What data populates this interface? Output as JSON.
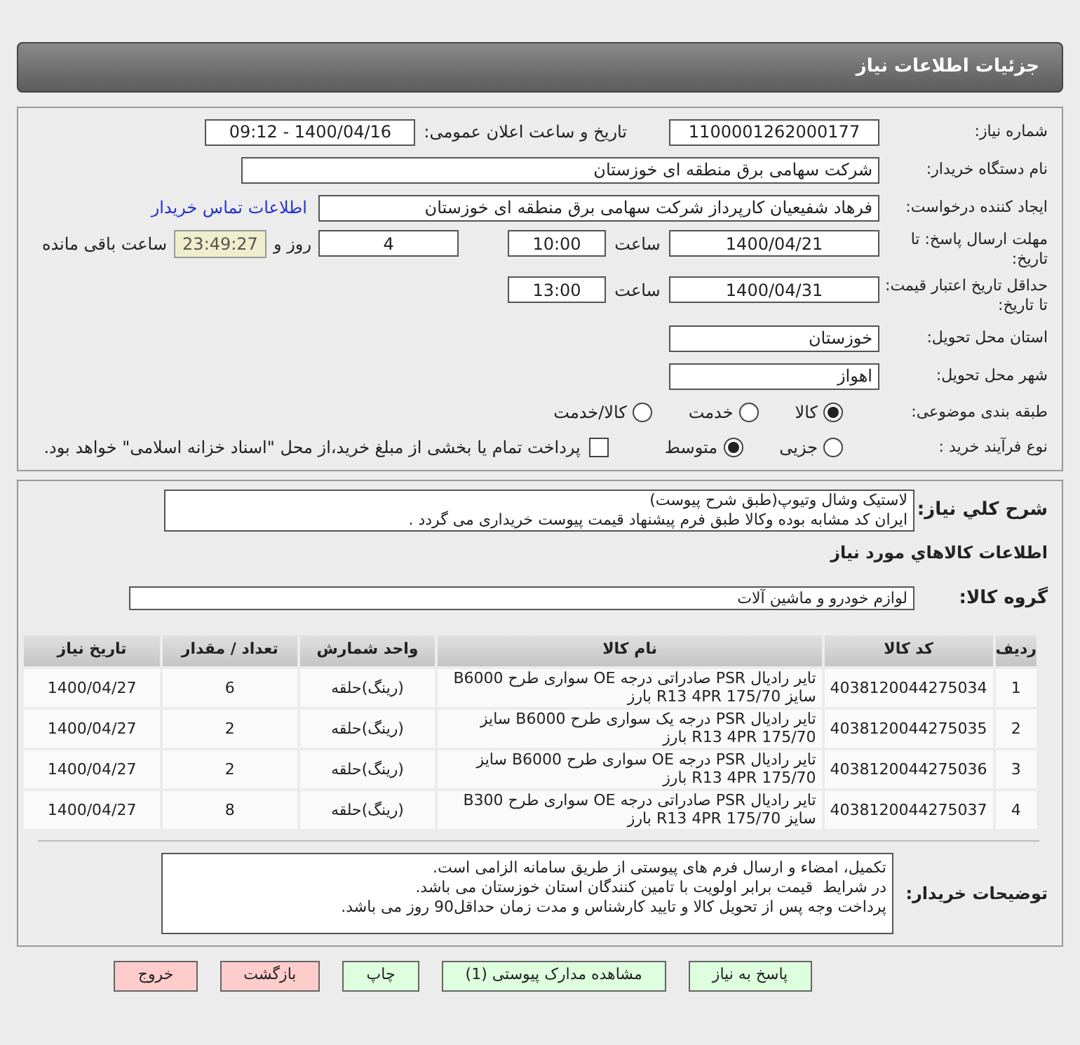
{
  "header": {
    "title": "جزئیات اطلاعات نیاز"
  },
  "need_number": {
    "label": "شماره نیاز:",
    "value": "1100001262000177"
  },
  "announce": {
    "label": "تاریخ و ساعت اعلان عمومی:",
    "value": "1400/04/16 - 09:12"
  },
  "buyer_org": {
    "label": "نام دستگاه خریدار:",
    "value": "شرکت سهامی برق منطقه ای خوزستان"
  },
  "requester": {
    "label": "ایجاد کننده درخواست:",
    "value": "فرهاد شفیعیان کارپرداز شرکت سهامی برق منطقه ای خوزستان",
    "link": "اطلاعات تماس خریدار"
  },
  "deadline": {
    "label": "مهلت ارسال پاسخ: تا تاریخ:",
    "date": "1400/04/21",
    "time_label": "ساعت",
    "time": "10:00",
    "days": "4",
    "days_label": "روز و",
    "remaining": "23:49:27",
    "remaining_label": "ساعت باقی مانده"
  },
  "validity": {
    "label": "حداقل تاریخ اعتبار قیمت: تا تاریخ:",
    "date": "1400/04/31",
    "time_label": "ساعت",
    "time": "13:00"
  },
  "province": {
    "label": "استان محل تحویل:",
    "value": "خوزستان"
  },
  "city": {
    "label": "شهر محل تحویل:",
    "value": "اهواز"
  },
  "category": {
    "label": "طبقه بندی موضوعی:",
    "options": [
      {
        "label": "کالا",
        "selected": true
      },
      {
        "label": "خدمت",
        "selected": false
      },
      {
        "label": "کالا/خدمت",
        "selected": false
      }
    ]
  },
  "process": {
    "label": "نوع فرآیند خرید :",
    "options": [
      {
        "label": "جزیی",
        "selected": false
      },
      {
        "label": "متوسط",
        "selected": true
      }
    ],
    "payment": {
      "checked": false,
      "label": "پرداخت تمام یا بخشی از مبلغ خرید،از محل \"اسناد خزانه اسلامی\" خواهد بود."
    }
  },
  "description": {
    "label": "شرح کلي نياز:",
    "lines": [
      "لاستیک وشال وتیوپ(طبق شرح پیوست)",
      "ایران کد مشابه بوده وکالا طبق فرم پیشنهاد قیمت پیوست خریداری می گردد ."
    ]
  },
  "items_title": "اطلاعات کالاهاي مورد نياز",
  "group": {
    "label": "گروه کالا:",
    "value": "لوازم خودرو و ماشین آلات"
  },
  "table": {
    "columns": [
      "ردیف",
      "کد کالا",
      "نام کالا",
      "واحد شمارش",
      "تعداد / مقدار",
      "تاریخ نیاز"
    ],
    "rows": [
      [
        "1",
        "4038120044275034",
        "تایر رادیال PSR صادراتی درجه OE سواری طرح B6000 سایز 175/70 R13 4PR بارز",
        "(رینگ)حلقه",
        "6",
        "1400/04/27"
      ],
      [
        "2",
        "4038120044275035",
        "تایر رادیال PSR درجه یک سواری طرح B6000 سایز 175/70 R13 4PR بارز",
        "(رینگ)حلقه",
        "2",
        "1400/04/27"
      ],
      [
        "3",
        "4038120044275036",
        "تایر رادیال PSR درجه OE سواری طرح B6000 سایز 175/70 R13 4PR بارز",
        "(رینگ)حلقه",
        "2",
        "1400/04/27"
      ],
      [
        "4",
        "4038120044275037",
        "تایر رادیال PSR صادراتی درجه OE سواری طرح B300 سایز 175/70 R13 4PR بارز",
        "(رینگ)حلقه",
        "8",
        "1400/04/27"
      ]
    ]
  },
  "notes": {
    "label": "توضیحات خریدار:",
    "lines": [
      "تکمیل، امضاء و ارسال فرم های پیوستی از طریق سامانه الزامی است.",
      "در شرایط  قیمت برابر اولویت با تامین کنندگان استان خوزستان می باشد.",
      "پرداخت وجه پس از تحویل کالا و تایید کارشناس و مدت زمان حداقل90 روز می باشد."
    ]
  },
  "buttons": [
    {
      "label": "پاسخ به نیاز",
      "kind": "action"
    },
    {
      "label": "مشاهده مدارک پیوستی (1)",
      "kind": "action"
    },
    {
      "label": "چاپ",
      "kind": "action"
    },
    {
      "label": "بازگشت",
      "kind": "exit"
    },
    {
      "label": "خروج",
      "kind": "exit"
    }
  ]
}
